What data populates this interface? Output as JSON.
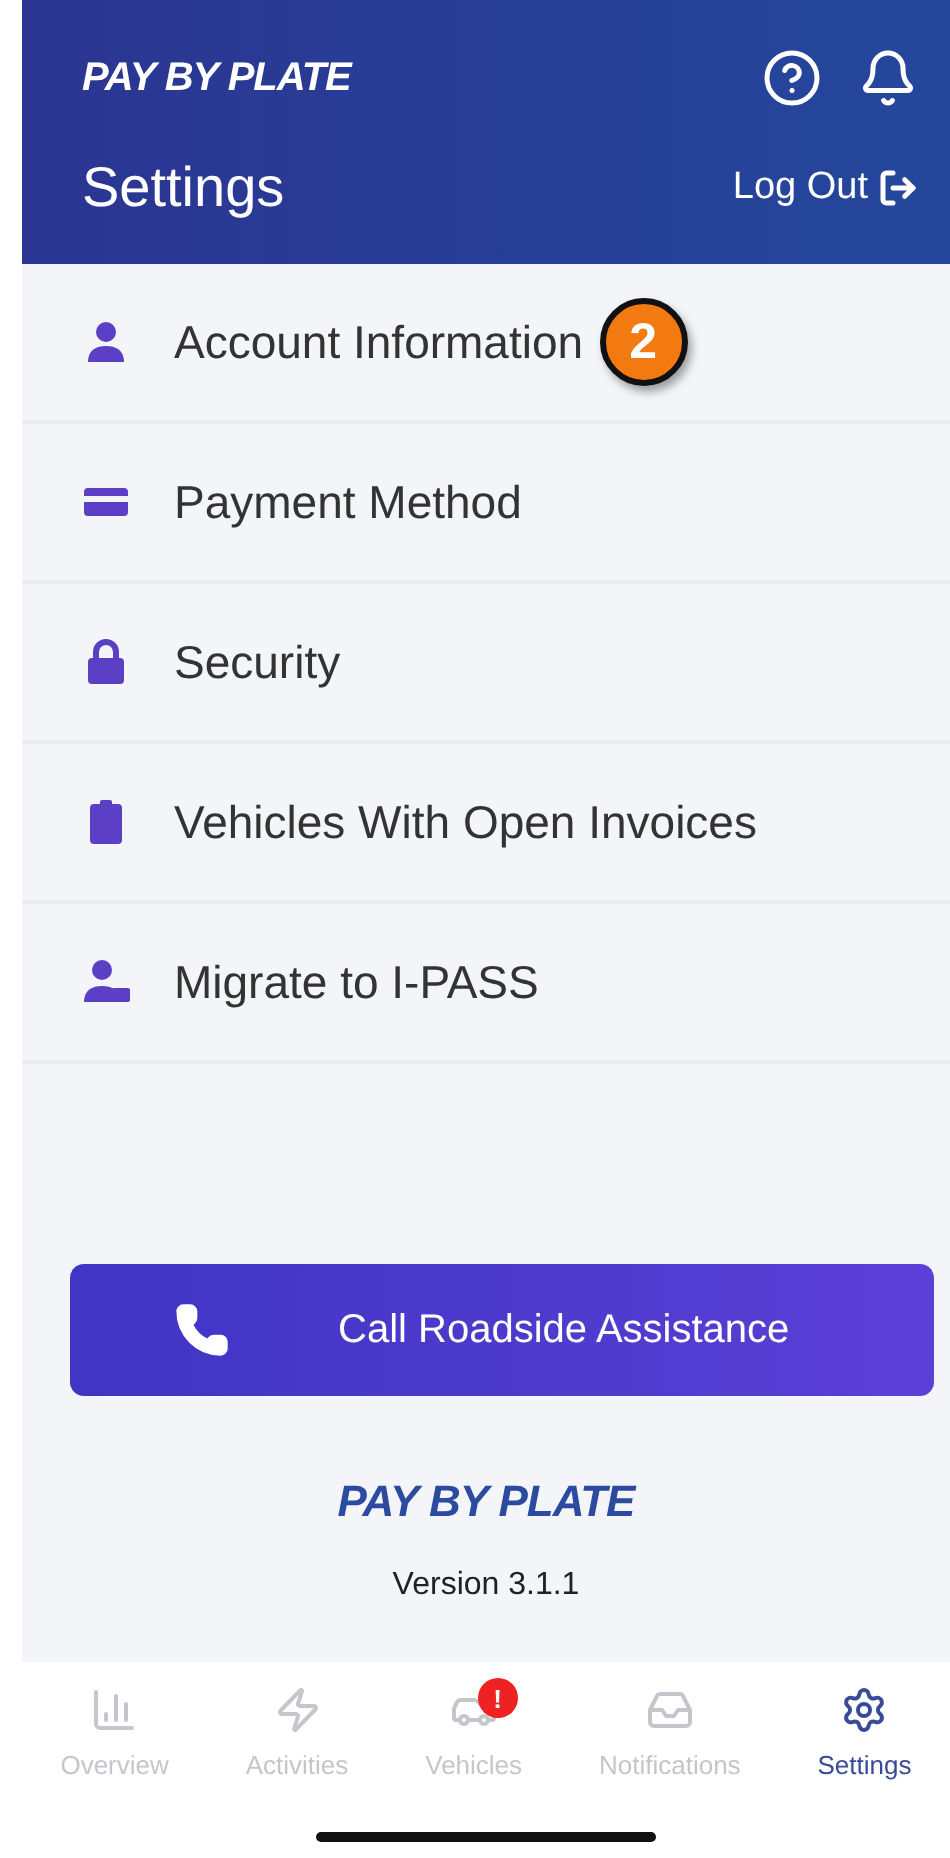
{
  "header": {
    "brand": "PAY BY PLATE",
    "title": "Settings",
    "logout": "Log Out"
  },
  "menu": [
    {
      "kind": "person",
      "label": "Account Information",
      "callout": "2"
    },
    {
      "kind": "card",
      "label": "Payment Method"
    },
    {
      "kind": "lock",
      "label": "Security"
    },
    {
      "kind": "invoice",
      "label": "Vehicles With Open Invoices"
    },
    {
      "kind": "migrate",
      "label": "Migrate to I-PASS"
    }
  ],
  "call_button": "Call Roadside Assistance",
  "footer": {
    "brand": "PAY BY PLATE",
    "version": "Version 3.1.1"
  },
  "tabs": [
    {
      "kind": "chart",
      "label": "Overview",
      "selected": false
    },
    {
      "kind": "bolt",
      "label": "Activities",
      "selected": false
    },
    {
      "kind": "car",
      "label": "Vehicles",
      "selected": false,
      "badge": "!"
    },
    {
      "kind": "inbox",
      "label": "Notifications",
      "selected": false
    },
    {
      "kind": "gear",
      "label": "Settings",
      "selected": true
    }
  ]
}
